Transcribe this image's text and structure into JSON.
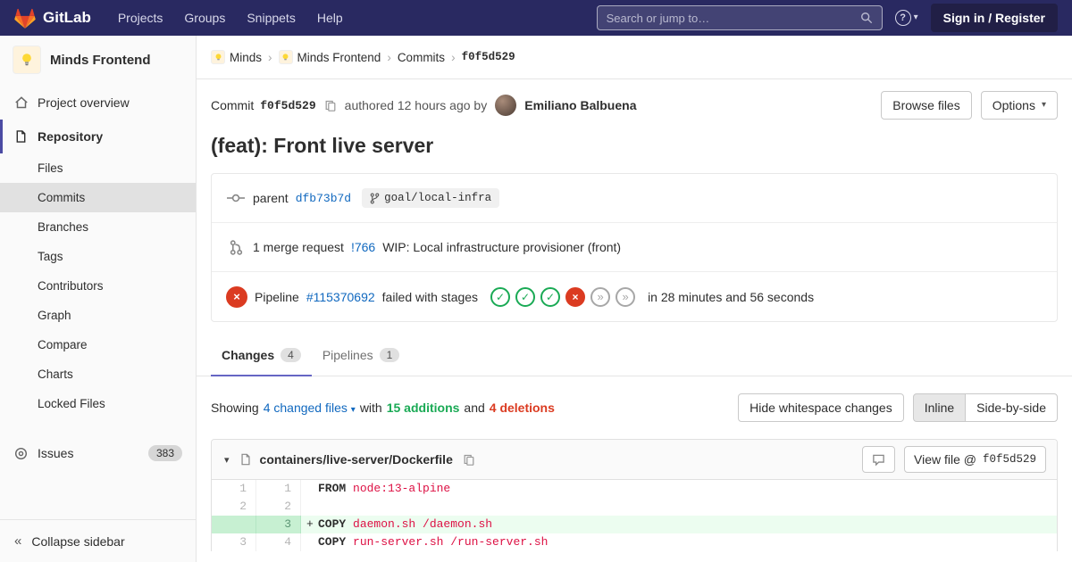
{
  "colors": {
    "navbar_bg": "#292961",
    "signin_bg": "#211f46",
    "brand_red": "#e24329",
    "brand_orange": "#fc6d26",
    "brand_yellow": "#fca326",
    "accent": "#6666c4",
    "accent_dark": "#4b4ba3",
    "link": "#1068bf",
    "success": "#1aaa55",
    "danger": "#db3b21",
    "sidebar_bg": "#fafafa",
    "border": "#e5e5e5",
    "active_item_bg": "#e1e1e1",
    "added_line_bg": "#ecfdf0",
    "added_num_bg": "#c7f0d2",
    "code_keyword": "#2e2e2e",
    "code_string": "#dd1144",
    "chip_bg": "#f0f0f0",
    "muted": "#707070"
  },
  "glyphs": {
    "question": "?",
    "caret_down": "▾",
    "crumb_sep": "›",
    "collapse": "«",
    "stage_passed": "✓",
    "stage_failed": "×",
    "stage_skipped": "»"
  },
  "navbar": {
    "brand": "GitLab",
    "menu": [
      "Projects",
      "Groups",
      "Snippets",
      "Help"
    ],
    "search_placeholder": "Search or jump to…",
    "sign_in": "Sign in / Register"
  },
  "sidebar": {
    "project_name": "Minds Frontend",
    "overview_label": "Project overview",
    "repository_label": "Repository",
    "repo_items": [
      "Files",
      "Commits",
      "Branches",
      "Tags",
      "Contributors",
      "Graph",
      "Compare",
      "Charts",
      "Locked Files"
    ],
    "active_repo_item": "Commits",
    "issues_label": "Issues",
    "issues_count": "383",
    "collapse_label": "Collapse sidebar"
  },
  "breadcrumb": {
    "items": [
      {
        "label": "Minds",
        "avatar": true
      },
      {
        "label": "Minds Frontend",
        "avatar": true
      },
      {
        "label": "Commits"
      },
      {
        "label": "f0f5d529",
        "current": true
      }
    ]
  },
  "commit": {
    "label": "Commit",
    "sha": "f0f5d529",
    "authored_text": "authored 12 hours ago by",
    "author_name": "Emiliano Balbuena",
    "browse_files_label": "Browse files",
    "options_label": "Options",
    "title": "(feat): Front live server",
    "parent": {
      "label": "parent",
      "sha": "dfb73b7d",
      "branch": "goal/local-infra"
    },
    "merge_request": {
      "count_text": "1 merge request",
      "id": "!766",
      "title": "WIP: Local infrastructure provisioner (front)"
    },
    "pipeline": {
      "label": "Pipeline",
      "id": "#115370692",
      "status_text": "failed with stages",
      "stages": [
        "passed",
        "passed",
        "passed",
        "failed",
        "skipped",
        "skipped"
      ],
      "duration_text": "in 28 minutes and 56 seconds"
    }
  },
  "tabs": {
    "changes_label": "Changes",
    "changes_count": "4",
    "pipelines_label": "Pipelines",
    "pipelines_count": "1"
  },
  "summary": {
    "showing_label": "Showing",
    "files_dropdown": "4 changed files",
    "with_label": "with",
    "additions_text": "15 additions",
    "and_label": "and",
    "deletions_text": "4 deletions",
    "hide_whitespace_label": "Hide whitespace changes",
    "inline_label": "Inline",
    "side_by_side_label": "Side-by-side"
  },
  "diff": {
    "file_name": "containers/live-server/Dockerfile",
    "view_file_label": "View file @",
    "view_file_sha": "f0f5d529",
    "lines": [
      {
        "old": "1",
        "new": "1",
        "sign": "",
        "type": "context",
        "segments": [
          {
            "c": "kw",
            "t": "FROM"
          },
          {
            "c": "str",
            "t": " node:13-alpine"
          }
        ]
      },
      {
        "old": "2",
        "new": "2",
        "sign": "",
        "type": "context",
        "segments": []
      },
      {
        "old": "",
        "new": "3",
        "sign": "+",
        "type": "add",
        "segments": [
          {
            "c": "kw",
            "t": "COPY"
          },
          {
            "c": "str",
            "t": " daemon.sh /daemon.sh"
          }
        ]
      },
      {
        "old": "3",
        "new": "4",
        "sign": "",
        "type": "context",
        "segments": [
          {
            "c": "kw",
            "t": "COPY"
          },
          {
            "c": "str",
            "t": " run-server.sh /run-server.sh"
          }
        ]
      }
    ]
  }
}
